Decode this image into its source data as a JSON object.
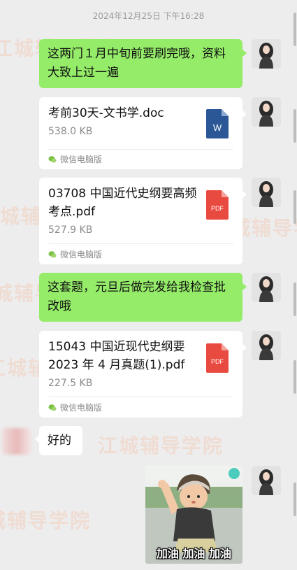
{
  "chat": {
    "timestamp": "2024年12月25日 下午16:28",
    "watermark_text": "江城辅导学院",
    "messages": {
      "msg1": "这两门１月中旬前要刷完哦，资料大致上过一遍",
      "file1": {
        "name": "考前30天-文书学.doc",
        "size": "538.0 KB",
        "source": "微信电脑版",
        "icon": "word-icon",
        "icon_letter": "W",
        "icon_color": "#2b5797"
      },
      "file2": {
        "name": "03708 中国近代史纲要高频考点.pdf",
        "size": "527.9 KB",
        "source": "微信电脑版",
        "icon": "pdf-icon",
        "icon_letter": "PDF",
        "icon_color": "#e94a3f"
      },
      "msg2": "这套题，元旦后做完发给我检查批改哦",
      "file3": {
        "name": "15043 中国近现代史纲要 2023 年 4 月真题(1).pdf",
        "size": "227.5 KB",
        "source": "微信电脑版",
        "icon": "pdf-icon",
        "icon_letter": "PDF",
        "icon_color": "#e94a3f"
      },
      "reply1": "好的",
      "sticker_caption": "加油 加油 加油"
    }
  },
  "colors": {
    "background": "#ededed",
    "sent_bubble": "#95ec69",
    "received_bubble": "#ffffff",
    "timestamp_text": "#9a9a9a"
  }
}
